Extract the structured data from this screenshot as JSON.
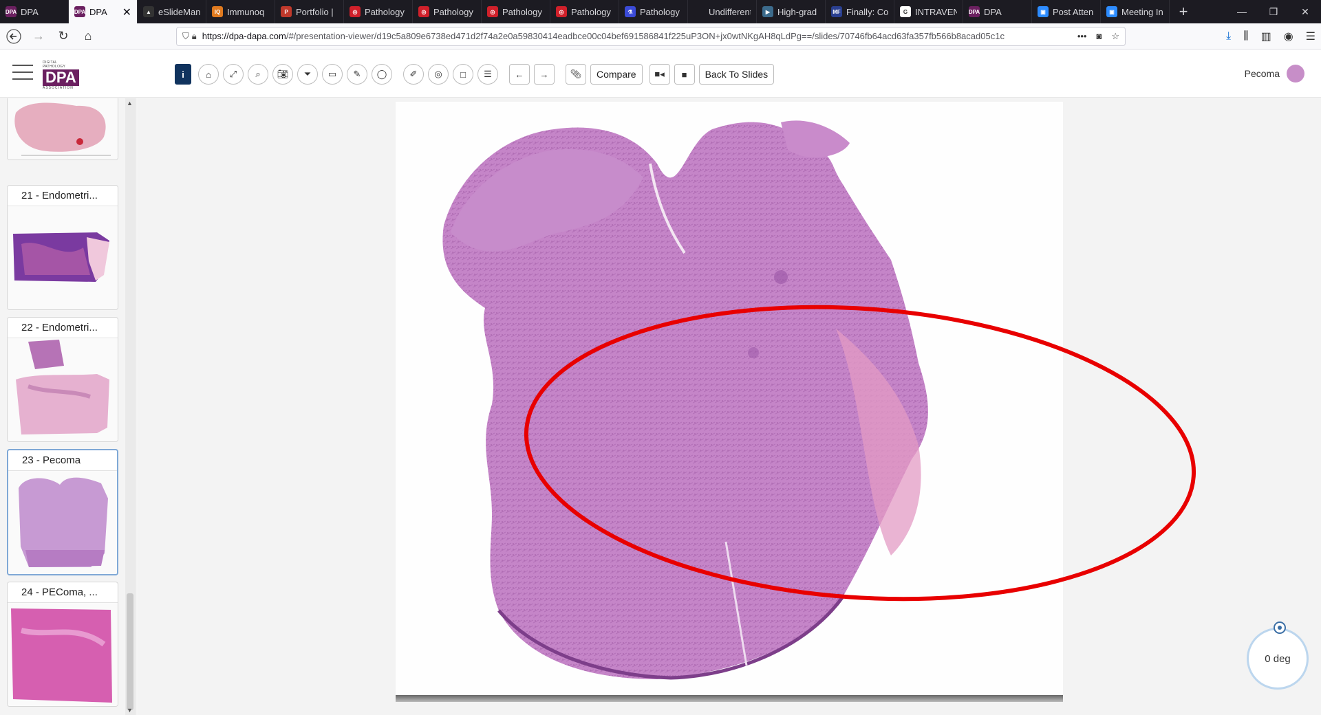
{
  "browser": {
    "tabs": [
      {
        "label": "DPA",
        "fav_color": "#6b2060",
        "fav_text": "DPA"
      },
      {
        "label": "DPA",
        "fav_color": "#6b2060",
        "fav_text": "DPA",
        "active": true
      },
      {
        "label": "eSlideMan",
        "fav_color": "#333333",
        "fav_text": "▲"
      },
      {
        "label": "Immunoq",
        "fav_color": "#e07a1f",
        "fav_text": "IQ"
      },
      {
        "label": "Portfolio |",
        "fav_color": "#c0392b",
        "fav_text": "P"
      },
      {
        "label": "Pathology",
        "fav_color": "#d0202a",
        "fav_text": "◎"
      },
      {
        "label": "Pathology",
        "fav_color": "#d0202a",
        "fav_text": "◎"
      },
      {
        "label": "Pathology",
        "fav_color": "#d0202a",
        "fav_text": "◎"
      },
      {
        "label": "Pathology",
        "fav_color": "#d0202a",
        "fav_text": "◎"
      },
      {
        "label": "Pathology",
        "fav_color": "#3b4bd8",
        "fav_text": "⚗"
      },
      {
        "label": "Undifferentiat",
        "fav_color": "#1c1b22",
        "fav_text": ""
      },
      {
        "label": "High-grad",
        "fav_color": "#3c6b8c",
        "fav_text": "▶"
      },
      {
        "label": "Finally: Co",
        "fav_color": "#2a3f8f",
        "fav_text": "MF"
      },
      {
        "label": "INTRAVEN",
        "fav_color": "#ffffff",
        "fav_text": "G"
      },
      {
        "label": "DPA",
        "fav_color": "#6b2060",
        "fav_text": "DPA"
      },
      {
        "label": "Post Atten",
        "fav_color": "#2d8cff",
        "fav_text": "▣"
      },
      {
        "label": "Meeting In",
        "fav_color": "#2d8cff",
        "fav_text": "▣"
      }
    ],
    "url_host": "https://dpa-dapa.com",
    "url_path": "/#/presentation-viewer/d19c5a809e6738ed471d2f74a2e0a59830414eadbce00c04bef691586841f225uP3ON+jx0wtNKgAH8qLdPg==/slides/70746fb64acd63fa357fb566b8acad05c1c"
  },
  "toolbar": {
    "compare_label": "Compare",
    "back_label": "Back To Slides"
  },
  "user": {
    "name": "Pecoma"
  },
  "sidebar": {
    "cards": [
      {
        "title": "21 - Endometri..."
      },
      {
        "title": "22 - Endometri..."
      },
      {
        "title": "23 - Pecoma",
        "selected": true
      },
      {
        "title": "24 - PEComa, ..."
      }
    ]
  },
  "viewer": {
    "rotation": "0 deg",
    "annotation_color": "#e80000",
    "tissue_color": "#c07fc4"
  }
}
